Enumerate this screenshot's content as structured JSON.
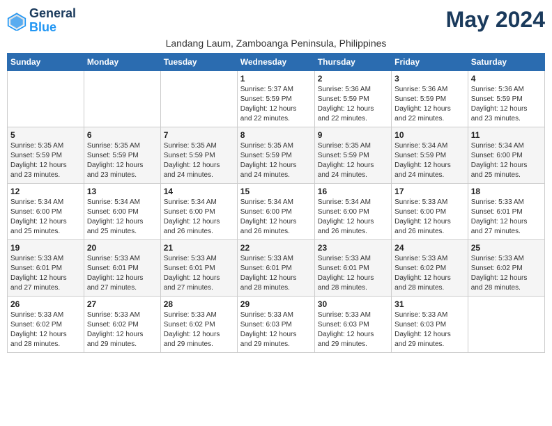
{
  "header": {
    "logo_line1": "General",
    "logo_line2": "Blue",
    "month_title": "May 2024",
    "location": "Landang Laum, Zamboanga Peninsula, Philippines"
  },
  "weekdays": [
    "Sunday",
    "Monday",
    "Tuesday",
    "Wednesday",
    "Thursday",
    "Friday",
    "Saturday"
  ],
  "weeks": [
    [
      {
        "day": "",
        "info": ""
      },
      {
        "day": "",
        "info": ""
      },
      {
        "day": "",
        "info": ""
      },
      {
        "day": "1",
        "info": "Sunrise: 5:37 AM\nSunset: 5:59 PM\nDaylight: 12 hours\nand 22 minutes."
      },
      {
        "day": "2",
        "info": "Sunrise: 5:36 AM\nSunset: 5:59 PM\nDaylight: 12 hours\nand 22 minutes."
      },
      {
        "day": "3",
        "info": "Sunrise: 5:36 AM\nSunset: 5:59 PM\nDaylight: 12 hours\nand 22 minutes."
      },
      {
        "day": "4",
        "info": "Sunrise: 5:36 AM\nSunset: 5:59 PM\nDaylight: 12 hours\nand 23 minutes."
      }
    ],
    [
      {
        "day": "5",
        "info": "Sunrise: 5:35 AM\nSunset: 5:59 PM\nDaylight: 12 hours\nand 23 minutes."
      },
      {
        "day": "6",
        "info": "Sunrise: 5:35 AM\nSunset: 5:59 PM\nDaylight: 12 hours\nand 23 minutes."
      },
      {
        "day": "7",
        "info": "Sunrise: 5:35 AM\nSunset: 5:59 PM\nDaylight: 12 hours\nand 24 minutes."
      },
      {
        "day": "8",
        "info": "Sunrise: 5:35 AM\nSunset: 5:59 PM\nDaylight: 12 hours\nand 24 minutes."
      },
      {
        "day": "9",
        "info": "Sunrise: 5:35 AM\nSunset: 5:59 PM\nDaylight: 12 hours\nand 24 minutes."
      },
      {
        "day": "10",
        "info": "Sunrise: 5:34 AM\nSunset: 5:59 PM\nDaylight: 12 hours\nand 24 minutes."
      },
      {
        "day": "11",
        "info": "Sunrise: 5:34 AM\nSunset: 6:00 PM\nDaylight: 12 hours\nand 25 minutes."
      }
    ],
    [
      {
        "day": "12",
        "info": "Sunrise: 5:34 AM\nSunset: 6:00 PM\nDaylight: 12 hours\nand 25 minutes."
      },
      {
        "day": "13",
        "info": "Sunrise: 5:34 AM\nSunset: 6:00 PM\nDaylight: 12 hours\nand 25 minutes."
      },
      {
        "day": "14",
        "info": "Sunrise: 5:34 AM\nSunset: 6:00 PM\nDaylight: 12 hours\nand 26 minutes."
      },
      {
        "day": "15",
        "info": "Sunrise: 5:34 AM\nSunset: 6:00 PM\nDaylight: 12 hours\nand 26 minutes."
      },
      {
        "day": "16",
        "info": "Sunrise: 5:34 AM\nSunset: 6:00 PM\nDaylight: 12 hours\nand 26 minutes."
      },
      {
        "day": "17",
        "info": "Sunrise: 5:33 AM\nSunset: 6:00 PM\nDaylight: 12 hours\nand 26 minutes."
      },
      {
        "day": "18",
        "info": "Sunrise: 5:33 AM\nSunset: 6:01 PM\nDaylight: 12 hours\nand 27 minutes."
      }
    ],
    [
      {
        "day": "19",
        "info": "Sunrise: 5:33 AM\nSunset: 6:01 PM\nDaylight: 12 hours\nand 27 minutes."
      },
      {
        "day": "20",
        "info": "Sunrise: 5:33 AM\nSunset: 6:01 PM\nDaylight: 12 hours\nand 27 minutes."
      },
      {
        "day": "21",
        "info": "Sunrise: 5:33 AM\nSunset: 6:01 PM\nDaylight: 12 hours\nand 27 minutes."
      },
      {
        "day": "22",
        "info": "Sunrise: 5:33 AM\nSunset: 6:01 PM\nDaylight: 12 hours\nand 28 minutes."
      },
      {
        "day": "23",
        "info": "Sunrise: 5:33 AM\nSunset: 6:01 PM\nDaylight: 12 hours\nand 28 minutes."
      },
      {
        "day": "24",
        "info": "Sunrise: 5:33 AM\nSunset: 6:02 PM\nDaylight: 12 hours\nand 28 minutes."
      },
      {
        "day": "25",
        "info": "Sunrise: 5:33 AM\nSunset: 6:02 PM\nDaylight: 12 hours\nand 28 minutes."
      }
    ],
    [
      {
        "day": "26",
        "info": "Sunrise: 5:33 AM\nSunset: 6:02 PM\nDaylight: 12 hours\nand 28 minutes."
      },
      {
        "day": "27",
        "info": "Sunrise: 5:33 AM\nSunset: 6:02 PM\nDaylight: 12 hours\nand 29 minutes."
      },
      {
        "day": "28",
        "info": "Sunrise: 5:33 AM\nSunset: 6:02 PM\nDaylight: 12 hours\nand 29 minutes."
      },
      {
        "day": "29",
        "info": "Sunrise: 5:33 AM\nSunset: 6:03 PM\nDaylight: 12 hours\nand 29 minutes."
      },
      {
        "day": "30",
        "info": "Sunrise: 5:33 AM\nSunset: 6:03 PM\nDaylight: 12 hours\nand 29 minutes."
      },
      {
        "day": "31",
        "info": "Sunrise: 5:33 AM\nSunset: 6:03 PM\nDaylight: 12 hours\nand 29 minutes."
      },
      {
        "day": "",
        "info": ""
      }
    ]
  ]
}
